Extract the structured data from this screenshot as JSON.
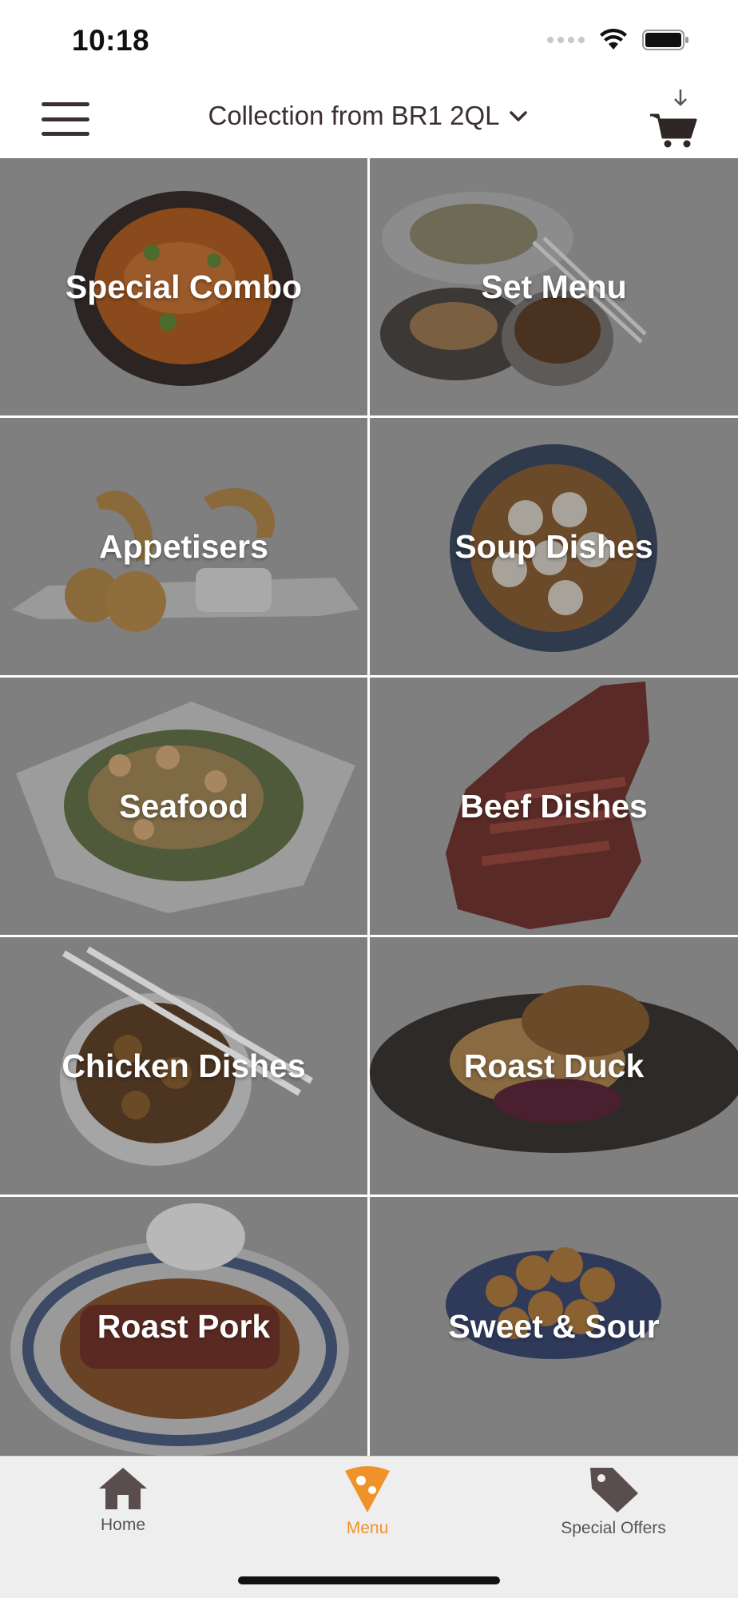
{
  "status_bar": {
    "time": "10:18"
  },
  "header": {
    "location": "Collection from BR1 2QL",
    "icons": [
      "hamburger-menu-icon",
      "chevron-down-icon",
      "cart-icon"
    ]
  },
  "categories": [
    {
      "label": "Special Combo"
    },
    {
      "label": "Set Menu"
    },
    {
      "label": "Appetisers"
    },
    {
      "label": "Soup Dishes"
    },
    {
      "label": "Seafood"
    },
    {
      "label": "Beef Dishes"
    },
    {
      "label": "Chicken Dishes"
    },
    {
      "label": "Roast Duck"
    },
    {
      "label": "Roast Pork"
    },
    {
      "label": "Sweet & Sour"
    }
  ],
  "bottom_nav": {
    "items": [
      {
        "label": "Home",
        "icon": "home-icon"
      },
      {
        "label": "Menu",
        "icon": "pizza-slice-icon",
        "active": true
      },
      {
        "label": "Special Offers",
        "icon": "tag-icon"
      }
    ]
  },
  "colors": {
    "accent": "#f0922a",
    "tile_overlay": "#7f7f7f",
    "nav_background": "#eeeeee",
    "icon_dark": "#5a4d4d"
  }
}
